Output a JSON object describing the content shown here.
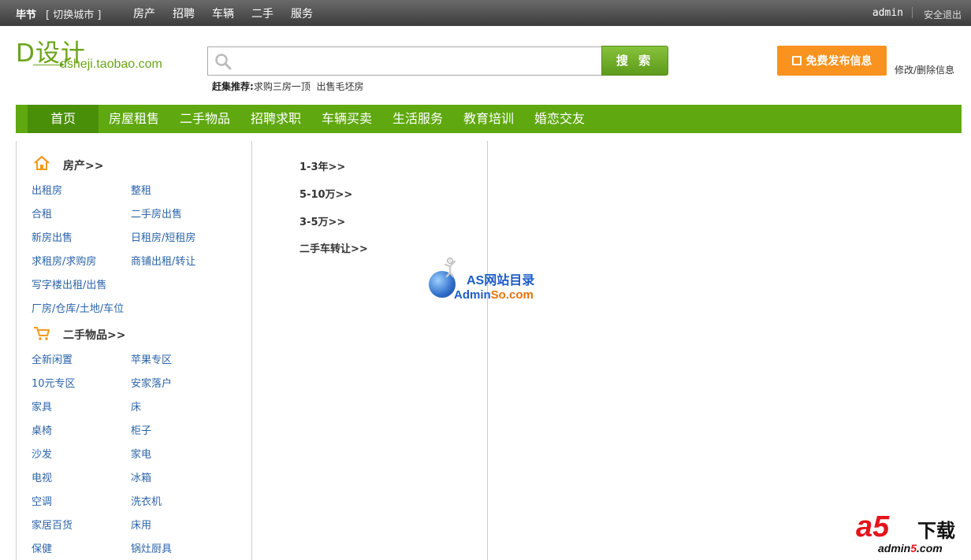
{
  "topbar": {
    "city": "毕节",
    "switch": "[ 切换城市 ]",
    "nav": [
      "房产",
      "招聘",
      "车辆",
      "二手",
      "服务"
    ],
    "user": "admin",
    "logout": "安全退出"
  },
  "logo": {
    "big": "D设计",
    "small": "dsheji.taobao.com"
  },
  "search": {
    "placeholder": "",
    "button": "搜 索",
    "recommend_label": "赶集推荐:",
    "recommend_items": [
      "求购三房一顶",
      "出售毛坯房"
    ]
  },
  "post": {
    "button": "免费发布信息",
    "manage": "修改/删除信息"
  },
  "mainnav": {
    "home": "首页",
    "items": [
      "房屋租售",
      "二手物品",
      "招聘求职",
      "车辆买卖",
      "生活服务",
      "教育培训",
      "婚恋交友"
    ]
  },
  "left": {
    "house_title": "房产>>",
    "house_links": [
      "出租房",
      "整租",
      "合租",
      "二手房出售",
      "新房出售",
      "日租房/短租房",
      "求租房/求购房",
      "商铺出租/转让",
      "写字楼出租/出售",
      "厂房/仓库/土地/车位"
    ],
    "goods_title": "二手物品>>",
    "goods_links": [
      "全新闲置",
      "苹果专区",
      "10元专区",
      "安家落户",
      "家具",
      "床",
      "桌椅",
      "柜子",
      "沙发",
      "家电",
      "电视",
      "冰箱",
      "空调",
      "洗衣机",
      "家居百货",
      "床用",
      "保健",
      "锅灶厨具"
    ]
  },
  "middle": {
    "links": [
      "1-3年>>",
      "5-10万>>",
      "3-5万>>",
      "二手车转让>>"
    ]
  },
  "watermarks": {
    "as_title": "AS网站目录",
    "as_url_a": "Admin",
    "as_url_b": "So.com",
    "a5_logo": "a5",
    "a5_text": "下载",
    "a5_url_a": "admin",
    "a5_url_b": "5",
    "a5_url_c": ".com"
  },
  "colors": {
    "nav_green": "#5fa80f",
    "home_green": "#4a8f08",
    "orange": "#f7931e",
    "link_blue": "#2b64a8"
  }
}
